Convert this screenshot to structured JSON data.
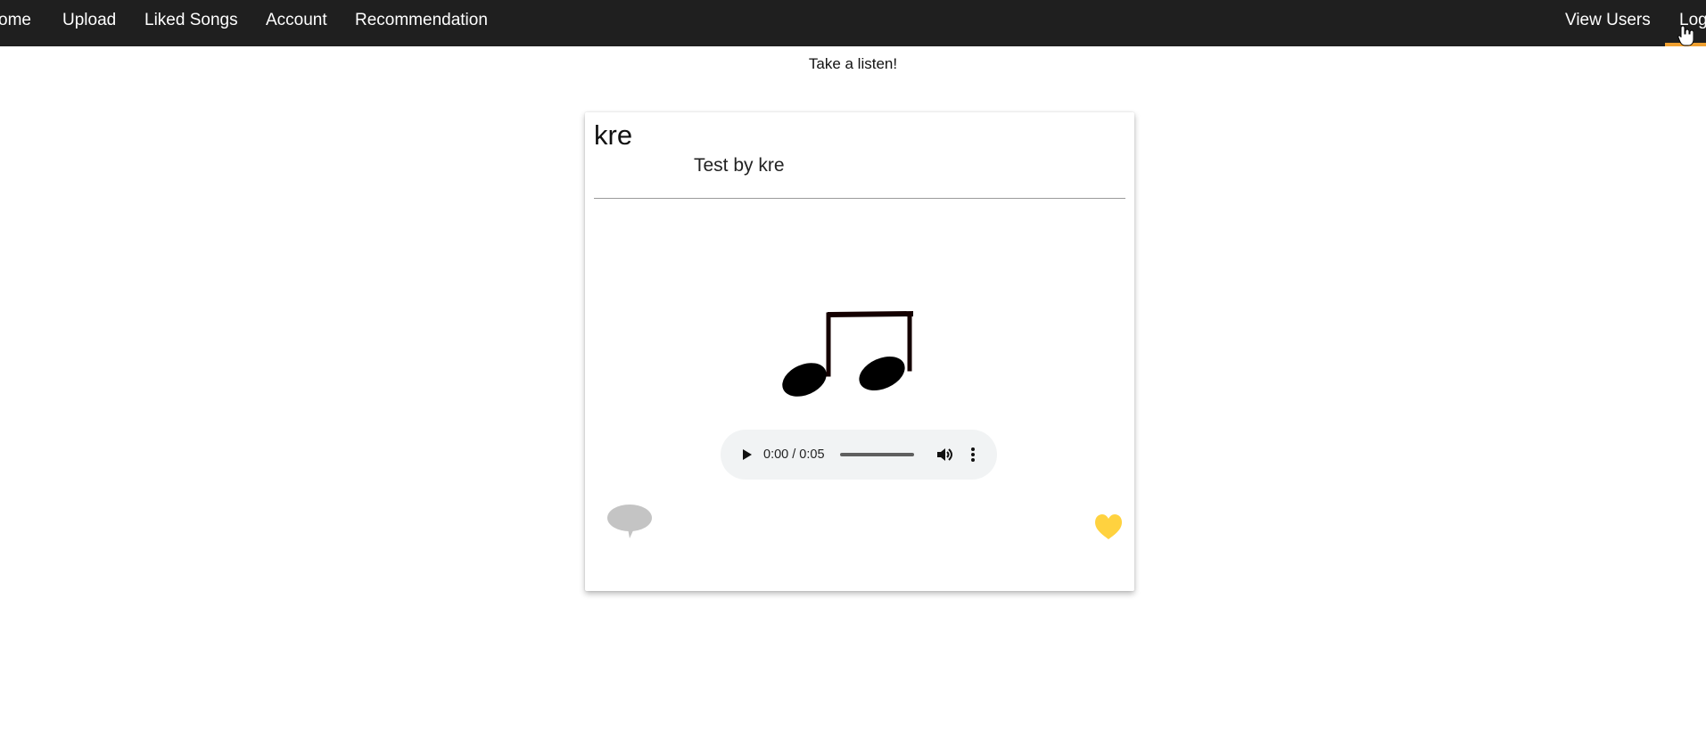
{
  "nav": {
    "left_items": [
      {
        "label": "ome"
      },
      {
        "label": "Upload"
      },
      {
        "label": "Liked Songs"
      },
      {
        "label": "Account"
      },
      {
        "label": "Recommendation"
      }
    ],
    "right_items": [
      {
        "label": "View Users"
      },
      {
        "label": "Log"
      }
    ]
  },
  "main": {
    "tagline": "Take a listen!"
  },
  "song": {
    "title": "kre",
    "subtitle": "Test by kre",
    "player": {
      "time": "0:00 / 0:05",
      "progress": 0
    }
  },
  "icons": {
    "music": "music-note-icon",
    "play": "play-icon",
    "volume": "volume-icon",
    "more": "more-vertical-icon",
    "comment": "comment-bubble-icon",
    "like": "heart-icon",
    "cursor": "hand-pointer-icon"
  },
  "colors": {
    "nav_background": "#1f1f1f",
    "nav_text": "#ffffff",
    "nav_active_underline": "#f0a030",
    "heart": "#ffd23f",
    "comment": "#c4c4c4",
    "player_background": "#f1f3f4"
  }
}
